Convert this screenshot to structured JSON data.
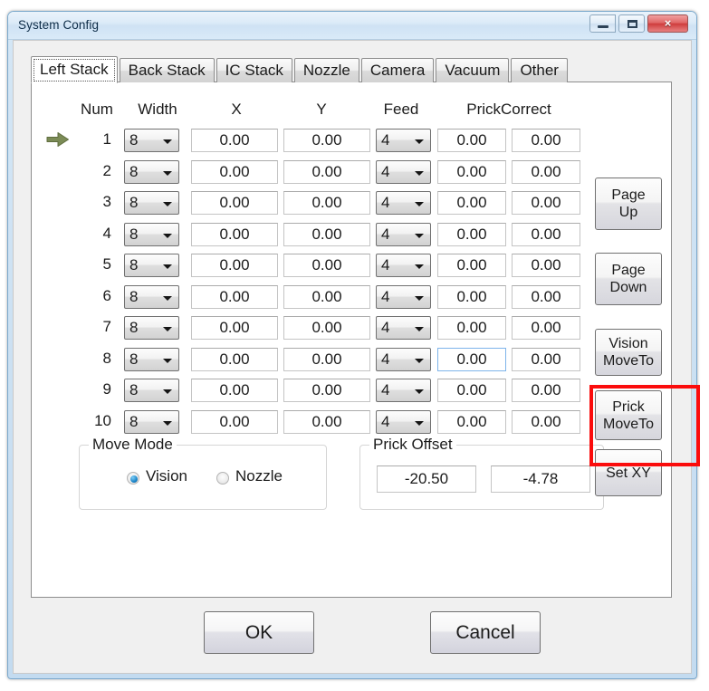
{
  "window": {
    "title": "System Config",
    "controls": {
      "minimize": "minimize-button",
      "maximize": "maximize-button",
      "close": "×"
    }
  },
  "tabs": [
    {
      "label": "Left Stack",
      "selected": true
    },
    {
      "label": "Back Stack",
      "selected": false
    },
    {
      "label": "IC Stack",
      "selected": false
    },
    {
      "label": "Nozzle",
      "selected": false
    },
    {
      "label": "Camera",
      "selected": false
    },
    {
      "label": "Vacuum",
      "selected": false
    },
    {
      "label": "Other",
      "selected": false
    }
  ],
  "table": {
    "headers": {
      "num": "Num",
      "width": "Width",
      "x": "X",
      "y": "Y",
      "feed": "Feed",
      "prick_correct": "PrickCorrect"
    },
    "active_row": 1,
    "focused_cell": {
      "row": 8,
      "column": "prick_correct_1"
    },
    "rows": [
      {
        "num": "1",
        "width": "8",
        "x": "0.00",
        "y": "0.00",
        "feed": "4",
        "prick1": "0.00",
        "prick2": "0.00"
      },
      {
        "num": "2",
        "width": "8",
        "x": "0.00",
        "y": "0.00",
        "feed": "4",
        "prick1": "0.00",
        "prick2": "0.00"
      },
      {
        "num": "3",
        "width": "8",
        "x": "0.00",
        "y": "0.00",
        "feed": "4",
        "prick1": "0.00",
        "prick2": "0.00"
      },
      {
        "num": "4",
        "width": "8",
        "x": "0.00",
        "y": "0.00",
        "feed": "4",
        "prick1": "0.00",
        "prick2": "0.00"
      },
      {
        "num": "5",
        "width": "8",
        "x": "0.00",
        "y": "0.00",
        "feed": "4",
        "prick1": "0.00",
        "prick2": "0.00"
      },
      {
        "num": "6",
        "width": "8",
        "x": "0.00",
        "y": "0.00",
        "feed": "4",
        "prick1": "0.00",
        "prick2": "0.00"
      },
      {
        "num": "7",
        "width": "8",
        "x": "0.00",
        "y": "0.00",
        "feed": "4",
        "prick1": "0.00",
        "prick2": "0.00"
      },
      {
        "num": "8",
        "width": "8",
        "x": "0.00",
        "y": "0.00",
        "feed": "4",
        "prick1": "0.00",
        "prick2": "0.00"
      },
      {
        "num": "9",
        "width": "8",
        "x": "0.00",
        "y": "0.00",
        "feed": "4",
        "prick1": "0.00",
        "prick2": "0.00"
      },
      {
        "num": "10",
        "width": "8",
        "x": "0.00",
        "y": "0.00",
        "feed": "4",
        "prick1": "0.00",
        "prick2": "0.00"
      }
    ]
  },
  "side_buttons": {
    "page_up_line1": "Page",
    "page_up_line2": "Up",
    "page_down_line1": "Page",
    "page_down_line2": "Down",
    "vision_moveto_line1": "Vision",
    "vision_moveto_line2": "MoveTo",
    "prick_moveto_line1": "Prick",
    "prick_moveto_line2": "MoveTo",
    "set_xy": "Set XY"
  },
  "move_mode": {
    "title": "Move Mode",
    "options": [
      {
        "label": "Vision",
        "selected": true
      },
      {
        "label": "Nozzle",
        "selected": false
      }
    ]
  },
  "prick_offset": {
    "title": "Prick Offset",
    "x": "-20.50",
    "y": "-4.78"
  },
  "footer": {
    "ok": "OK",
    "cancel": "Cancel"
  },
  "annotation": {
    "highlight_target": "prick-moveto-button",
    "color": "#fb0c0c"
  },
  "icons": {
    "row_marker": "green-right-arrow-icon"
  }
}
